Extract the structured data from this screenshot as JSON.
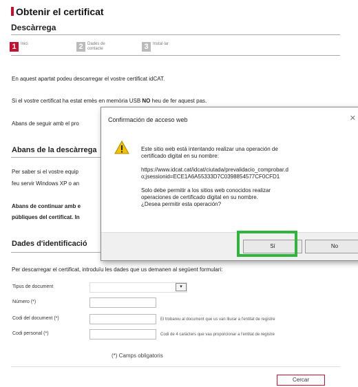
{
  "page": {
    "title": "Obtenir el certificat",
    "subtitle": "Descàrrega"
  },
  "steps": [
    {
      "num": "1",
      "label": "Inici"
    },
    {
      "num": "2",
      "label": "Dades de contacte"
    },
    {
      "num": "3",
      "label": "Instal·lar"
    }
  ],
  "intro": {
    "p1": "En aquest apartat podeu descarregar el vostre certificat idCAT.",
    "p2_pre": "Si el vostre certificat ha estat emès en memòria USB ",
    "p2_bold": "NO",
    "p2_post": " heu de fer aquest pas.",
    "p3": "Abans de seguir amb el pro"
  },
  "section_before": {
    "heading": "Abans de la descàrrega",
    "p1": "Per saber si el vostre equip",
    "p2": "feu servir Windows XP o an",
    "p3": "Abans de continuar amb e",
    "p4": "públiques del certificat. In"
  },
  "identification": {
    "heading": "Dades d'identificació",
    "instructions": "Per descarregar el certificat, introduïu les dades que us demanen al següent formulari:",
    "doc_type_label": "Tipus de document",
    "number_label": "Número (*)",
    "doc_code_label": "Codi del document (*)",
    "doc_code_hint": "El trobareu al document que us van lliurar a l'entitat de registre",
    "personal_code_label": "Codi personal (*)",
    "personal_code_hint": "Codi de 4 caràcters que vau proporcionar a l'entitat de registre",
    "required_note": "(*) Camps obligatoris",
    "search_button": "Cercar"
  },
  "dialog": {
    "title": "Confirmación de acceso web",
    "line1": "Este sitio web está intentando realizar una operación de",
    "line2": "certificado digital en su nombre:",
    "url1": "https://www.idcat.cat/idcat/ciutada/prevalidacio_comprobar.d",
    "url2": "o;jsessionid=ECE1A6A55333D7C0398854577CF0CFD1",
    "q1": "Solo debe permitir a los sitios web conocidos realizar",
    "q2": "operaciones de certificado digital en su nombre.",
    "q3": "¿Desea permitir esta operación?",
    "yes_label": "Sí",
    "no_label": "No"
  },
  "colors": {
    "brand_red": "#c8102e",
    "highlight_green": "#2fb53c",
    "warning_yellow": "#f2c200"
  }
}
